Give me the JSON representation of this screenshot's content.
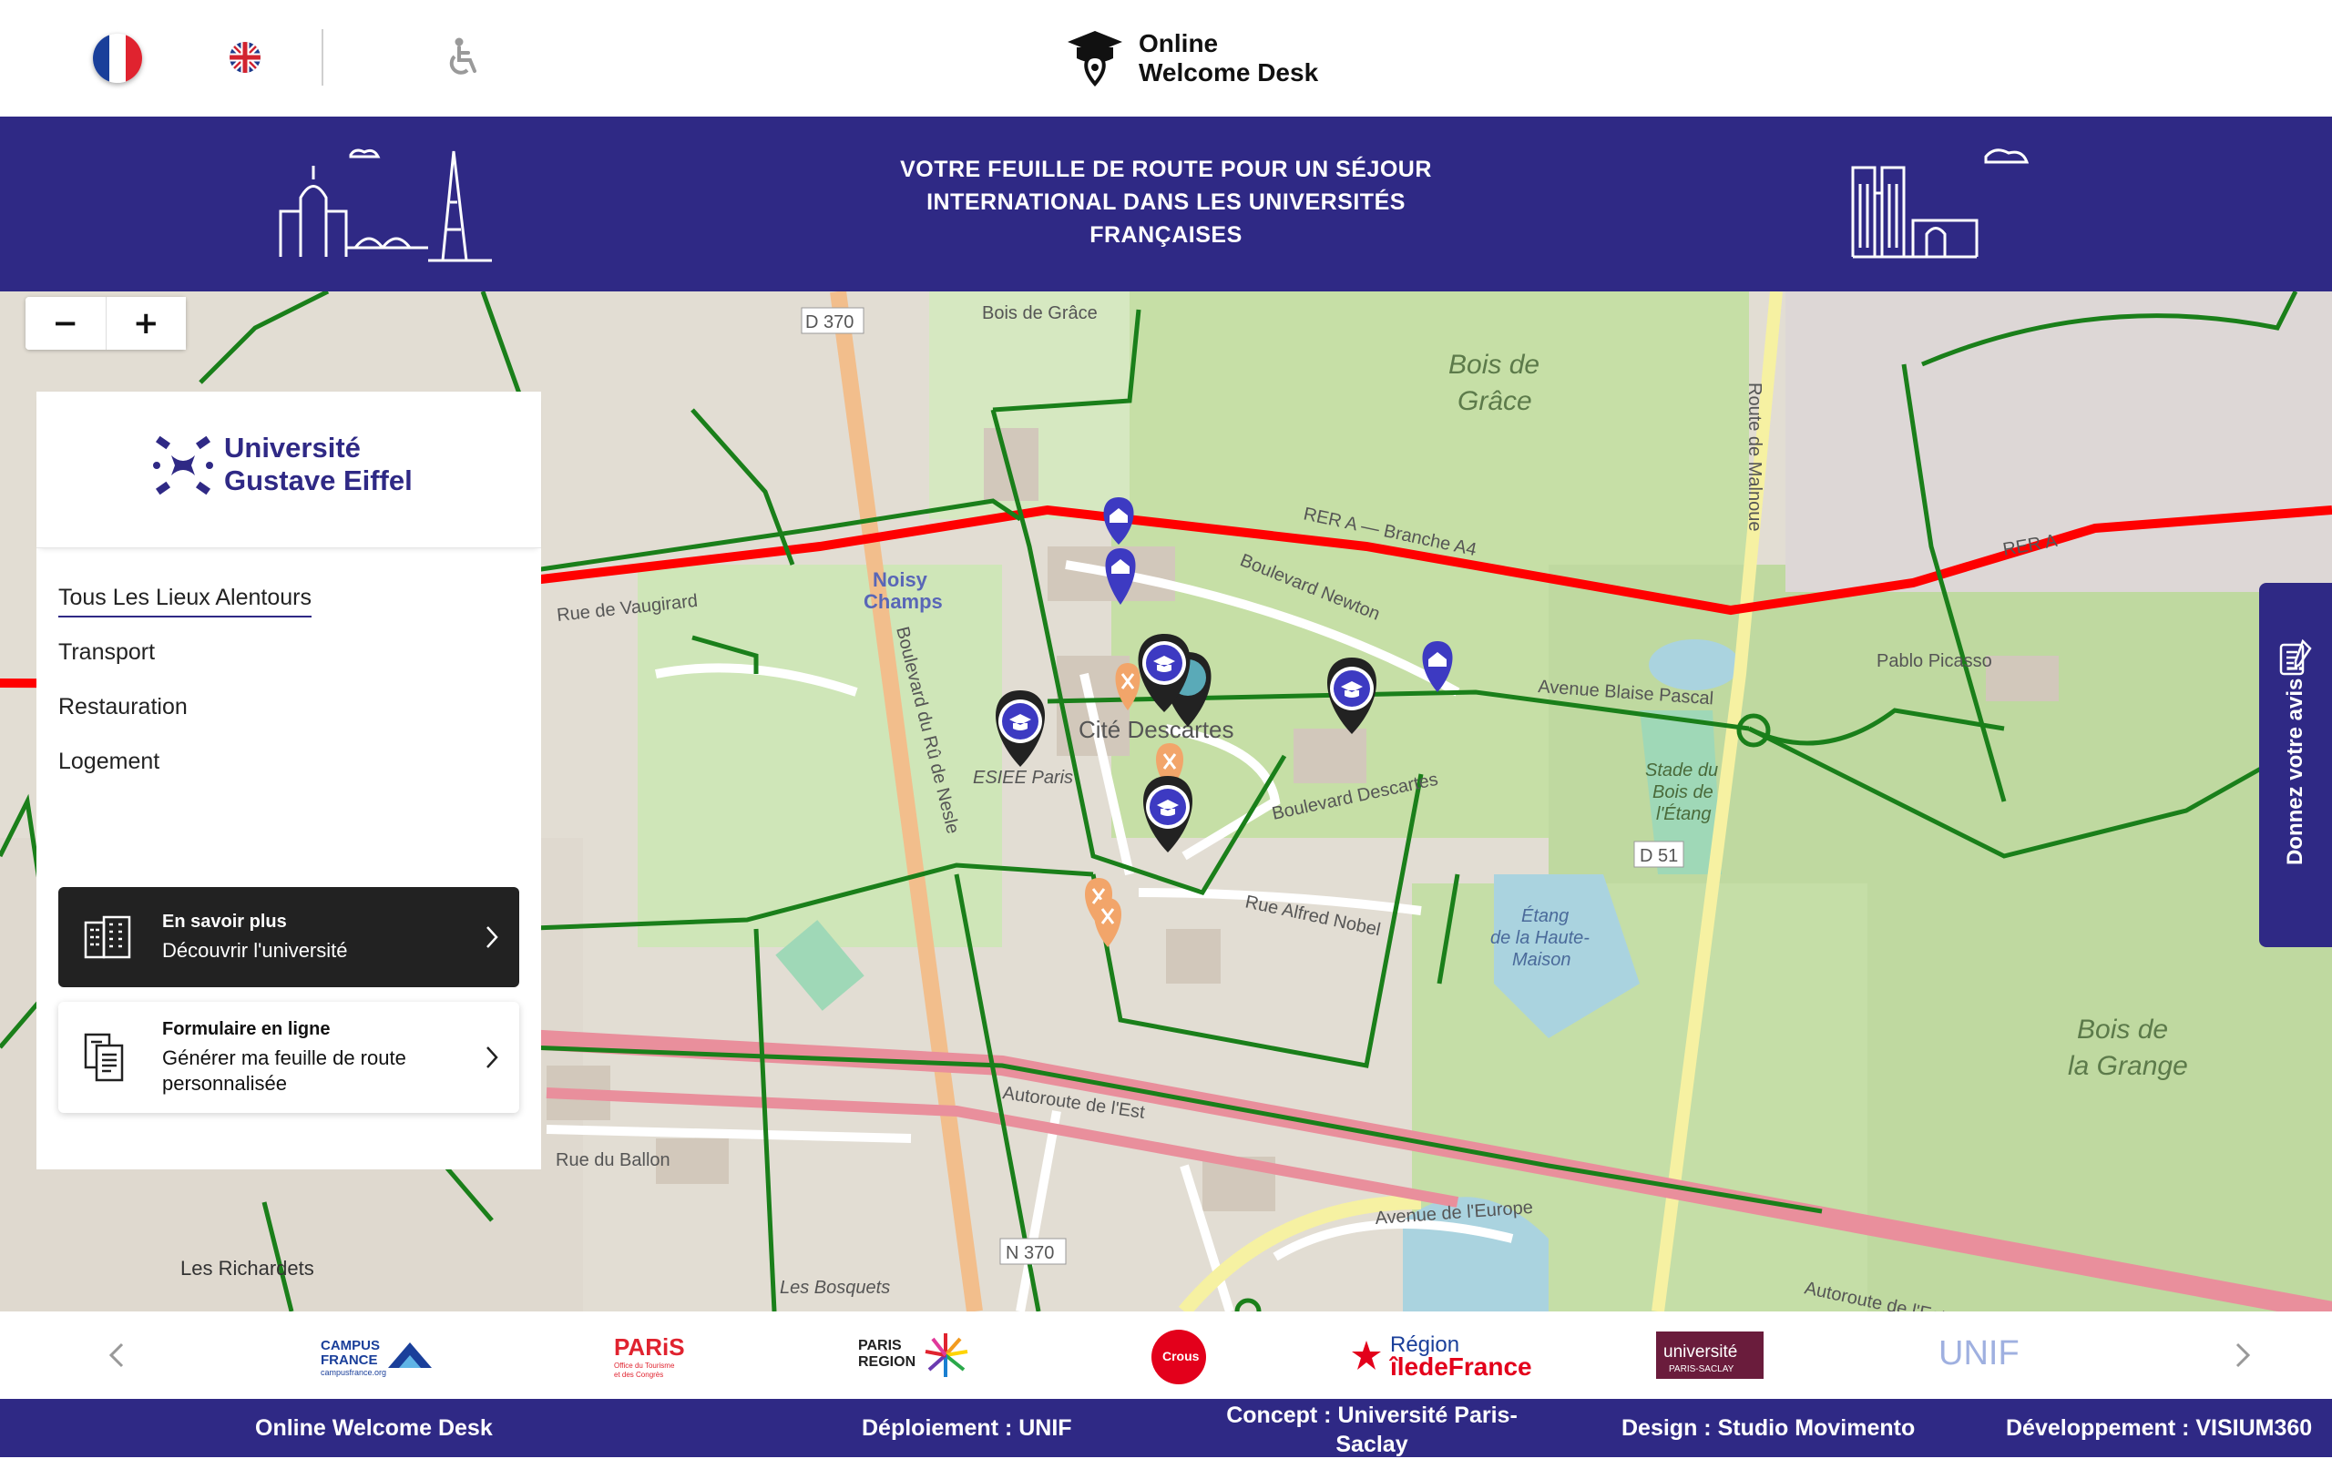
{
  "header": {
    "logo_line1": "Online",
    "logo_line2": "Welcome Desk",
    "icons": [
      "flag-fr-icon",
      "flag-uk-icon",
      "accessibility-icon"
    ]
  },
  "banner": {
    "title_line1": "VOTRE FEUILLE DE ROUTE POUR UN SÉJOUR",
    "title_line2": "INTERNATIONAL DANS LES UNIVERSITÉS",
    "title_line3": "FRANÇAISES"
  },
  "map": {
    "zoom_out": "−",
    "zoom_in": "+",
    "labels": [
      "D 370",
      "Bois de Grâce",
      "Bois de",
      "Grâce",
      "RER A — Branche A4",
      "Boulevard Newton",
      "Noisy",
      "Champs",
      "Cité Descartes",
      "ESIEE Paris",
      "Avenue Blaise Pascal",
      "Boulevard Descartes",
      "Rue Alfred Nobel",
      "Pablo Picasso",
      "Stade du",
      "Bois de",
      "l'Étang",
      "Étang",
      "de la Haute-",
      "Maison",
      "Bois de",
      "la Grange",
      "Autoroute de l'Est",
      "Autoroute de l'Est",
      "N 370",
      "Les Richardets",
      "Avenue de l'Europe",
      "Rue de Vaugirard",
      "Rue du Ballon",
      "Boulevard du Rû de Nesle",
      "Route de Malnoue",
      "RER A",
      "D 51",
      "Les Bosquets"
    ]
  },
  "panel": {
    "university_line1": "Université",
    "university_line2": "Gustave Eiffel",
    "menu": [
      "Tous Les Lieux Alentours",
      "Transport",
      "Restauration",
      "Logement"
    ],
    "card1_title": "En savoir plus",
    "card1_text": "Découvrir l'université",
    "card2_title": "Formulaire en ligne",
    "card2_text_line1": "Générer ma feuille de route",
    "card2_text_line2": "personnalisée"
  },
  "feedback": {
    "label": "Donnez votre avis !"
  },
  "partners": {
    "campus_line1": "CAMPUS",
    "campus_line2": "FRANCE",
    "campus_line3": "campusfrance.org",
    "paris": "PARiS",
    "paris_sub1": "Office du Tourisme",
    "paris_sub2": "et des Congrès",
    "region1": "PARIS",
    "region2": "REGION",
    "crous": "Crous",
    "idf1": "Région",
    "idf2": "îledeFrance",
    "ups1": "université",
    "ups2": "PARIS-SACLAY",
    "unif": "UNIF"
  },
  "footer": {
    "item1": "Online Welcome Desk",
    "item2": "Déploiement : UNIF",
    "item3_line1": "Concept : Université Paris-",
    "item3_line2": "Saclay",
    "item4": "Design : Studio Movimento",
    "item5": "Développement : VISIUM360"
  },
  "colors": {
    "primary": "#2f2985",
    "route": "#1a7f1a",
    "rer": "#ff0000",
    "dark_card": "#222222"
  }
}
